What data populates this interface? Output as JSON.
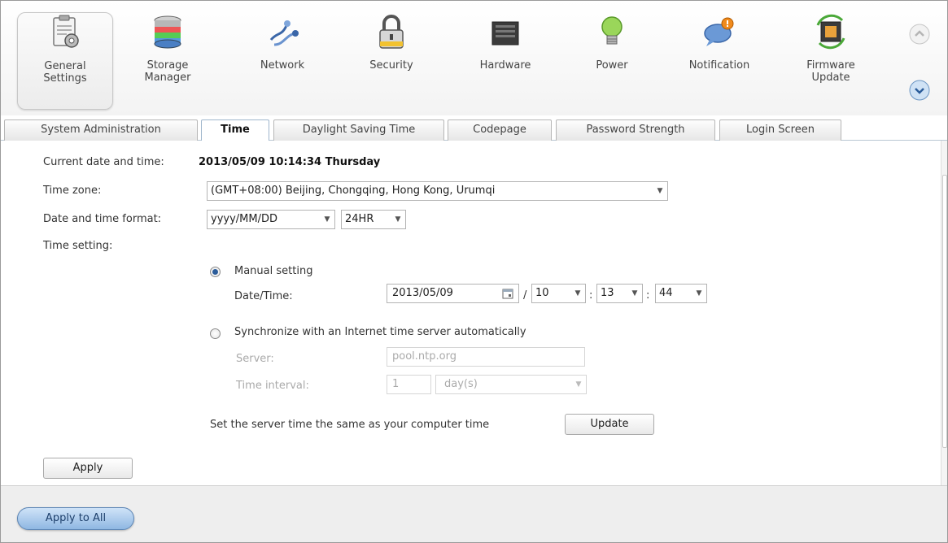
{
  "categories": [
    {
      "label_lines": [
        "General",
        "Settings"
      ],
      "icon": "general-settings-icon",
      "active": true
    },
    {
      "label_lines": [
        "Storage",
        "Manager"
      ],
      "icon": "storage-manager-icon",
      "active": false
    },
    {
      "label_lines": [
        "Network"
      ],
      "icon": "network-icon",
      "active": false
    },
    {
      "label_lines": [
        "Security"
      ],
      "icon": "security-lock-icon",
      "active": false
    },
    {
      "label_lines": [
        "Hardware"
      ],
      "icon": "hardware-icon",
      "active": false
    },
    {
      "label_lines": [
        "Power"
      ],
      "icon": "power-bulb-icon",
      "active": false
    },
    {
      "label_lines": [
        "Notification"
      ],
      "icon": "notification-icon",
      "active": false
    },
    {
      "label_lines": [
        "Firmware",
        "Update"
      ],
      "icon": "firmware-update-icon",
      "active": false
    }
  ],
  "tabs": [
    {
      "label": "System Administration",
      "active": false
    },
    {
      "label": "Time",
      "active": true
    },
    {
      "label": "Daylight Saving Time",
      "active": false
    },
    {
      "label": "Codepage",
      "active": false
    },
    {
      "label": "Password Strength",
      "active": false
    },
    {
      "label": "Login Screen",
      "active": false
    }
  ],
  "form": {
    "current_label": "Current date and time:",
    "current_value": "2013/05/09 10:14:34 Thursday",
    "timezone_label": "Time zone:",
    "timezone_value": "(GMT+08:00) Beijing, Chongqing, Hong Kong, Urumqi",
    "format_label": "Date and time format:",
    "date_format_value": "yyyy/MM/DD",
    "time_format_value": "24HR",
    "time_setting_label": "Time setting:",
    "manual_label": "Manual setting",
    "manual_selected": true,
    "datetime_label": "Date/Time:",
    "date_value": "2013/05/09",
    "hour_value": "10",
    "minute_value": "13",
    "second_value": "44",
    "slash": "/",
    "colon": ":",
    "sync_label": "Synchronize with an Internet time server automatically",
    "sync_selected": false,
    "server_label": "Server:",
    "server_value": "pool.ntp.org",
    "interval_label": "Time interval:",
    "interval_value": "1",
    "interval_unit": "day(s)",
    "set_server_text": "Set the server time the same as your computer time",
    "update_button": "Update",
    "apply_button": "Apply"
  },
  "footer": {
    "apply_all_button": "Apply to All"
  },
  "colors": {
    "accent": "#2b5c9a",
    "apply_all_bg": "#a9c9ec",
    "tab_active_text": "#111111"
  }
}
